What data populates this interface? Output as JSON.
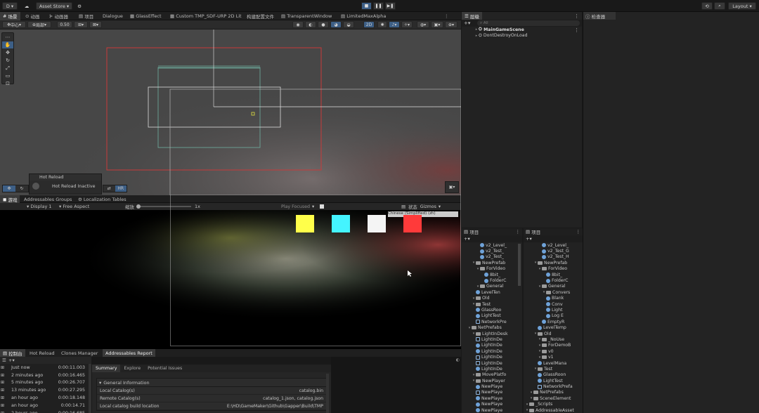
{
  "toolbar": {
    "account_label": "D",
    "asset_store": "Asset Store",
    "layout": "Layout",
    "play_icon": "play-icon",
    "pause_icon": "pause-icon",
    "step_icon": "step-icon"
  },
  "scene_tabs": [
    "场景",
    "动画",
    "动画器",
    "项目",
    "Dialogue",
    "GlassEffect",
    "Custom TMP_SDF-URP 2D Lit",
    "构建配置文件",
    "TransparentWindow",
    "LimitedMaxAlpha"
  ],
  "scene_toolbar": {
    "pivot": "中心",
    "space": "局部",
    "snap": "0.50",
    "mode_2d": "2D"
  },
  "hot_reload": {
    "title": "Hot Reload",
    "status": "Hot Reload Inactive",
    "hr_label": "HR"
  },
  "game_tabs": [
    "游戏",
    "Addressables Groups",
    "Localization Tables"
  ],
  "game_toolbar": {
    "display": "Display 1",
    "aspect": "Free Aspect",
    "scale_label": "缩放",
    "scale_value": "1x",
    "play_focused": "Play Focused",
    "stats": "状态",
    "gizmos": "Gizmos",
    "overlay_text": "Chinese (Simplified) (zh)"
  },
  "game_squares": [
    "#ffff4a",
    "#44f4ff",
    "#f4f4f4",
    "#ff3a3a"
  ],
  "bottom_tabs": [
    "控制台",
    "Hot Reload",
    "Clones Manager",
    "Addressables Report"
  ],
  "console_rows": [
    {
      "when": "Just now",
      "time": "0:00:11.003"
    },
    {
      "when": "2 minutes ago",
      "time": "0:00:16.465"
    },
    {
      "when": "5 minutes ago",
      "time": "0:00:26.707"
    },
    {
      "when": "13 minutes ago",
      "time": "0:00:27.295"
    },
    {
      "when": "an hour ago",
      "time": "0:00:18.148"
    },
    {
      "when": "an hour ago",
      "time": "0:00:14.71"
    },
    {
      "when": "2 hours ago",
      "time": "0:00:16.685"
    }
  ],
  "report": {
    "tabs": [
      "Summary",
      "Explore",
      "Potential Issues"
    ],
    "section": "General Information",
    "rows": [
      {
        "label": "Local Catalog(s)",
        "value": "catalog.bin"
      },
      {
        "label": "Remote Catalog(s)",
        "value": "catalog_1.json, catalog.json"
      },
      {
        "label": "Local catalog build location",
        "value": "E:\\HD\\GameMaker\\Github\\Gapper\\Build\\TMP"
      }
    ]
  },
  "hierarchy": {
    "title": "层级",
    "search": "All",
    "items": [
      {
        "label": "MainGameScene"
      },
      {
        "label": "DontDestroyOnLoad"
      }
    ]
  },
  "inspector": {
    "title": "检查器"
  },
  "project_left": {
    "title": "项目",
    "items": [
      {
        "label": "v2_Level_",
        "kind": "prefab",
        "indent": 4
      },
      {
        "label": "v2_Test_",
        "kind": "prefab",
        "indent": 4
      },
      {
        "label": "v2_Test_",
        "kind": "prefab",
        "indent": 4
      },
      {
        "label": "NewPrefab",
        "kind": "folder",
        "indent": 2
      },
      {
        "label": "ForVideo",
        "kind": "folder",
        "indent": 3
      },
      {
        "label": "8bit_",
        "kind": "prefab",
        "indent": 5
      },
      {
        "label": "FolderC",
        "kind": "prefab",
        "indent": 5
      },
      {
        "label": "General",
        "kind": "folder",
        "indent": 3
      },
      {
        "label": "LevelTen",
        "kind": "prefab",
        "indent": 3
      },
      {
        "label": "Old",
        "kind": "folder",
        "indent": 2
      },
      {
        "label": "Test",
        "kind": "folder",
        "indent": 2
      },
      {
        "label": "GlassRoo",
        "kind": "prefab",
        "indent": 3
      },
      {
        "label": "LightTest",
        "kind": "prefab",
        "indent": 3
      },
      {
        "label": "NetworkPre",
        "kind": "outline",
        "indent": 3
      },
      {
        "label": "NetPrefabs",
        "kind": "folder",
        "indent": 1
      },
      {
        "label": "LightInDesk",
        "kind": "folder",
        "indent": 2
      },
      {
        "label": "LightInDe",
        "kind": "outline",
        "indent": 3
      },
      {
        "label": "LightInDe",
        "kind": "prefab",
        "indent": 3
      },
      {
        "label": "LightInDe",
        "kind": "prefab",
        "indent": 3
      },
      {
        "label": "LightInDe",
        "kind": "outline",
        "indent": 3
      },
      {
        "label": "LightInDe",
        "kind": "outline",
        "indent": 3
      },
      {
        "label": "LightInDe",
        "kind": "prefab",
        "indent": 3
      },
      {
        "label": "MovePlatfo",
        "kind": "folder",
        "indent": 2
      },
      {
        "label": "NewPlayer",
        "kind": "folder",
        "indent": 2
      },
      {
        "label": "NewPlaye",
        "kind": "prefab",
        "indent": 3
      },
      {
        "label": "NewPlaye",
        "kind": "outline",
        "indent": 3
      },
      {
        "label": "NewPlaye",
        "kind": "prefab",
        "indent": 3
      },
      {
        "label": "NewPlaye",
        "kind": "prefab",
        "indent": 3
      },
      {
        "label": "NewPlaye",
        "kind": "prefab",
        "indent": 3
      }
    ]
  },
  "project_right": {
    "title": "项目",
    "items": [
      {
        "label": "v2_Level_",
        "kind": "prefab",
        "indent": 4
      },
      {
        "label": "v2_Test_G",
        "kind": "prefab",
        "indent": 4
      },
      {
        "label": "v2_Test_H",
        "kind": "prefab",
        "indent": 4
      },
      {
        "label": "NewPrefab",
        "kind": "folder",
        "indent": 2
      },
      {
        "label": "ForVideo",
        "kind": "folder",
        "indent": 3
      },
      {
        "label": "8bit_",
        "kind": "prefab",
        "indent": 5
      },
      {
        "label": "FolderC",
        "kind": "prefab",
        "indent": 5
      },
      {
        "label": "General",
        "kind": "folder",
        "indent": 3
      },
      {
        "label": "Convers",
        "kind": "folder",
        "indent": 4
      },
      {
        "label": "Blank",
        "kind": "prefab",
        "indent": 5
      },
      {
        "label": "Conv",
        "kind": "prefab",
        "indent": 5
      },
      {
        "label": "Light",
        "kind": "prefab",
        "indent": 5
      },
      {
        "label": "Log E",
        "kind": "prefab",
        "indent": 5
      },
      {
        "label": "EmptyR",
        "kind": "prefab",
        "indent": 4
      },
      {
        "label": "LevelTemp",
        "kind": "prefab",
        "indent": 3
      },
      {
        "label": "Old",
        "kind": "folder",
        "indent": 2
      },
      {
        "label": "_NoUse",
        "kind": "folder",
        "indent": 3
      },
      {
        "label": "ForDemoB",
        "kind": "folder",
        "indent": 3
      },
      {
        "label": "v0",
        "kind": "folder",
        "indent": 3
      },
      {
        "label": "v1",
        "kind": "folder",
        "indent": 3
      },
      {
        "label": "LevelMana",
        "kind": "prefab",
        "indent": 3
      },
      {
        "label": "Test",
        "kind": "folder",
        "indent": 2
      },
      {
        "label": "GlassRoon",
        "kind": "prefab",
        "indent": 3
      },
      {
        "label": "LightTest",
        "kind": "prefab",
        "indent": 3
      },
      {
        "label": "NetworkPrefa",
        "kind": "outline",
        "indent": 3
      },
      {
        "label": "NetPrefabs",
        "kind": "folder",
        "indent": 1
      },
      {
        "label": "SceneElement",
        "kind": "folder",
        "indent": 1
      },
      {
        "label": "_Scripts",
        "kind": "folder",
        "indent": 0
      },
      {
        "label": "AddressableAsset",
        "kind": "folder",
        "indent": 0
      }
    ]
  }
}
